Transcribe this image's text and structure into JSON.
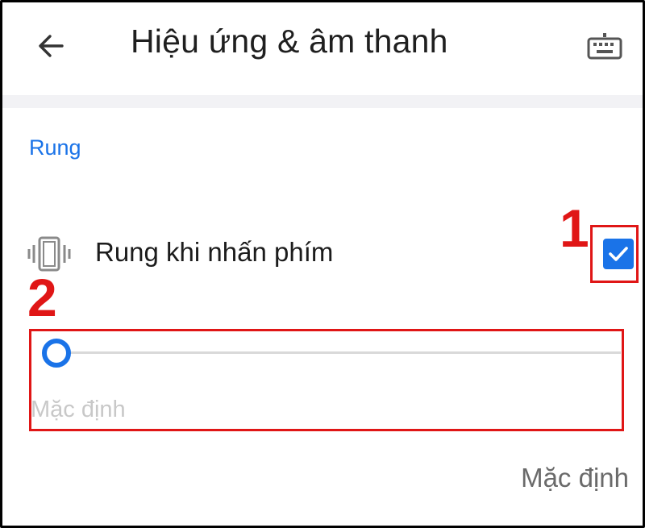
{
  "header": {
    "title": "Hiệu ứng & âm thanh",
    "back_icon": "arrow-left-icon",
    "keyboard_icon": "keyboard-icon"
  },
  "section": {
    "title": "Rung",
    "accent_color": "#1a73e8"
  },
  "vibrate_row": {
    "icon": "vibrate-icon",
    "label": "Rung khi nhấn phím",
    "checked": true
  },
  "slider": {
    "value_fraction": 0,
    "caption": "Mặc định"
  },
  "footer": {
    "default_button": "Mặc định"
  },
  "annotations": {
    "marker_1": "1",
    "marker_2": "2",
    "color": "#e01616"
  }
}
